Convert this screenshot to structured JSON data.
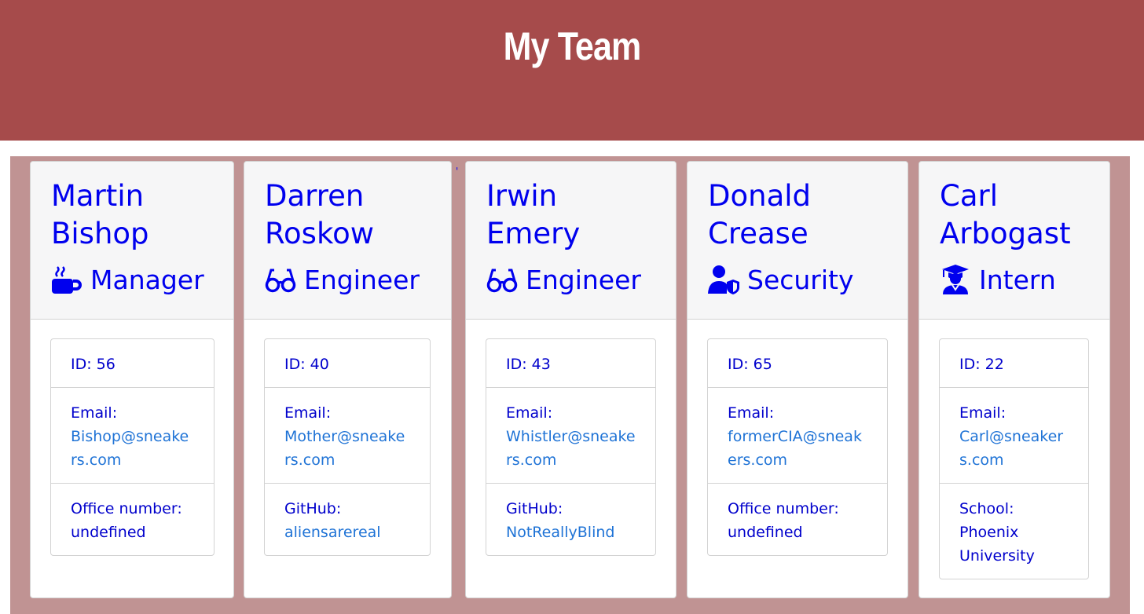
{
  "header": {
    "title": "My Team"
  },
  "stray_mark": "'",
  "cards": [
    {
      "name_line1": "Martin",
      "name_line2": "Bishop",
      "role": "Manager",
      "role_icon": "coffee-mug-icon",
      "id": "ID: 56",
      "email_label": "Email:",
      "email": "Bishop@sneakers.com",
      "extra_label": "Office number:",
      "extra_value": "undefined"
    },
    {
      "name_line1": "Darren",
      "name_line2": "Roskow",
      "role": "Engineer",
      "role_icon": "glasses-icon",
      "id": "ID: 40",
      "email_label": "Email:",
      "email": "Mother@sneakers.com",
      "extra_label": "GitHub:",
      "extra_value": "aliensarereal"
    },
    {
      "name_line1": "Irwin",
      "name_line2": "Emery",
      "role": "Engineer",
      "role_icon": "glasses-icon",
      "id": "ID: 43",
      "email_label": "Email:",
      "email": "Whistler@sneakers.com",
      "extra_label": "GitHub:",
      "extra_value": "NotReallyBlind"
    },
    {
      "name_line1": "Donald",
      "name_line2": "Crease",
      "role": "Security",
      "role_icon": "user-shield-icon",
      "id": "ID: 65",
      "email_label": "Email:",
      "email": "formerCIA@sneakers.com",
      "extra_label": "Office number:",
      "extra_value": "undefined"
    },
    {
      "name_line1": "Carl",
      "name_line2": "Arbogast",
      "role": "Intern",
      "role_icon": "graduate-icon",
      "id": "ID: 22",
      "email_label": "Email:",
      "email": "Carl@sneakers.com",
      "extra_label": "School:",
      "extra_value": "Phoenix University"
    }
  ],
  "colors": {
    "header_bg": "#a64b4b",
    "board_bg": "#c09393",
    "text_blue": "#0000ee",
    "link_blue": "#1f73d6"
  }
}
